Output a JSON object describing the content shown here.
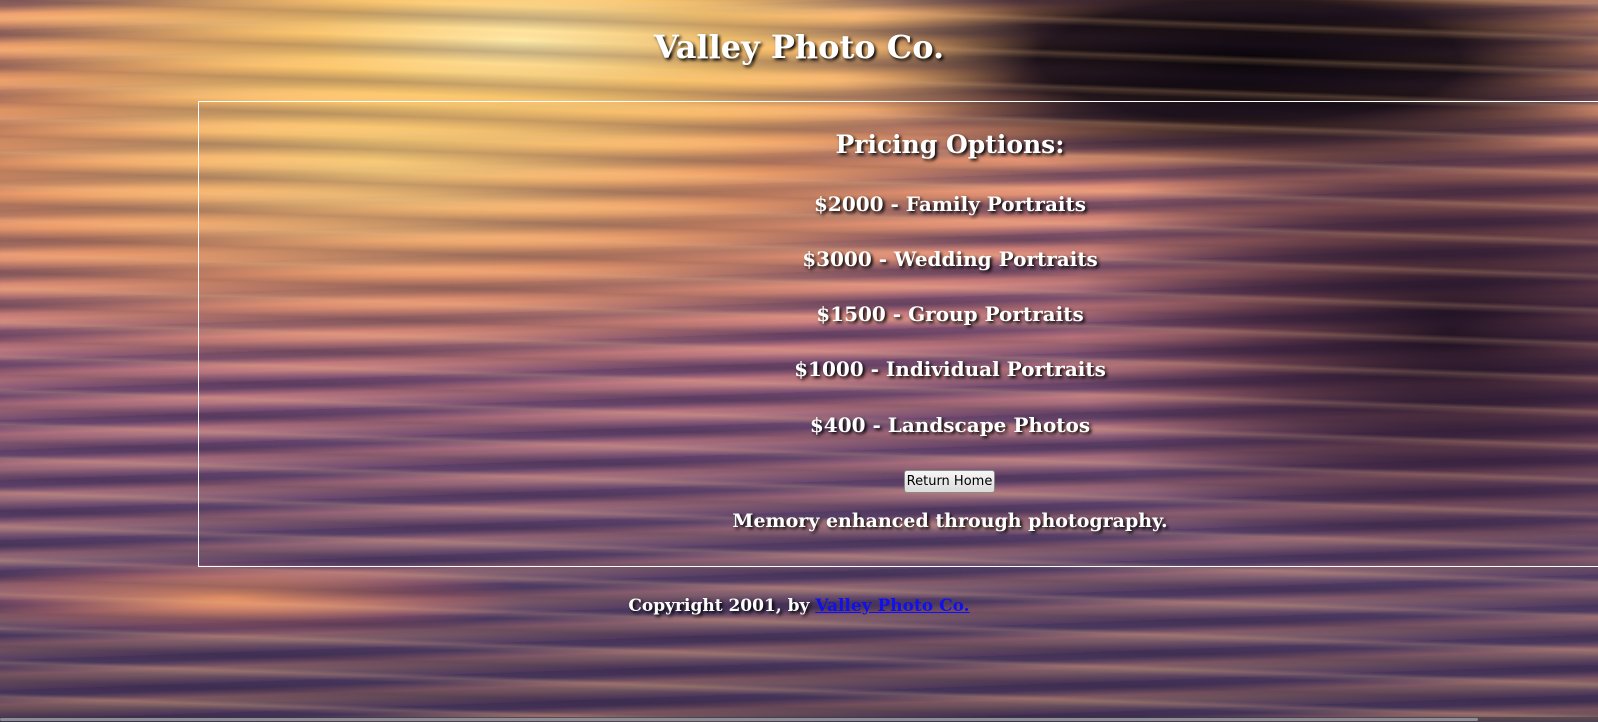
{
  "header": {
    "title": "Valley Photo Co."
  },
  "pricing": {
    "heading": "Pricing Options:",
    "items": [
      "$2000 - Family Portraits",
      "$3000 - Wedding Portraits",
      "$1500 - Group Portraits",
      "$1000 - Individual Portraits",
      "$400 - Landscape Photos"
    ],
    "return_button_label": "Return Home",
    "tagline": "Memory enhanced through photography."
  },
  "footer": {
    "copyright_text": "Copyright 2001, by ",
    "link_label": "Valley Photo Co."
  },
  "colors": {
    "text": "#ffffff",
    "link": "#1010ee"
  }
}
